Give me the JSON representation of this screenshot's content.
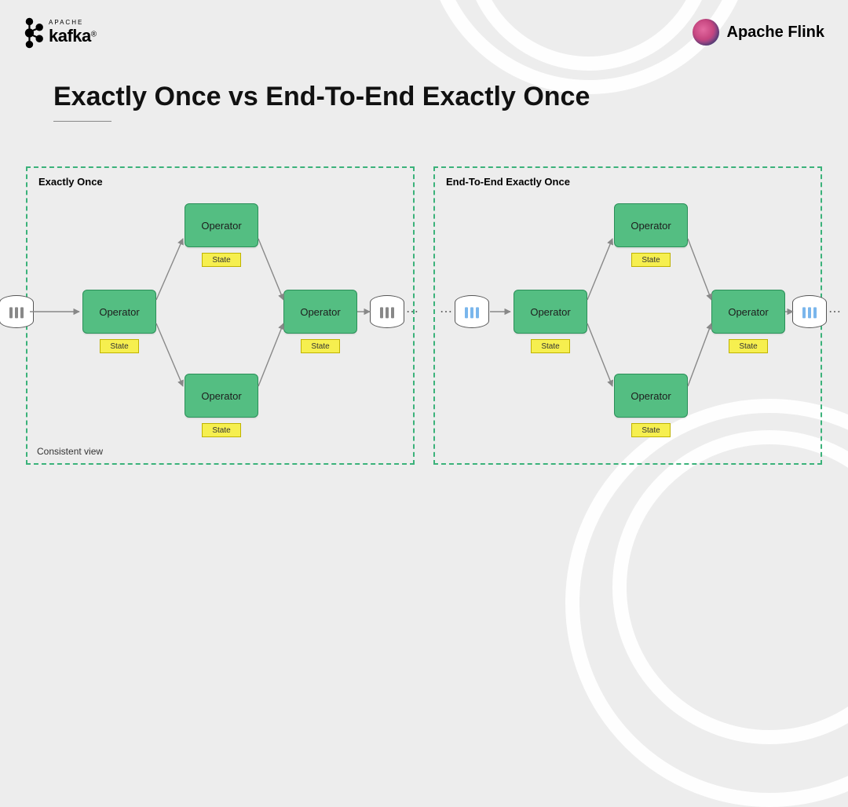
{
  "logos": {
    "kafka_super": "APACHE",
    "kafka_word": "kafka",
    "flink_word": "Apache Flink"
  },
  "title": "Exactly Once vs End-To-End Exactly Once",
  "panels": {
    "left": {
      "heading": "Exactly Once",
      "footer": "Consistent view",
      "operators": {
        "in": "Operator",
        "top": "Operator",
        "bottom": "Operator",
        "out": "Operator"
      },
      "state_label": "State"
    },
    "right": {
      "heading": "End-To-End Exactly Once",
      "operators": {
        "in": "Operator",
        "top": "Operator",
        "bottom": "Operator",
        "out": "Operator"
      },
      "state_label": "State"
    }
  }
}
